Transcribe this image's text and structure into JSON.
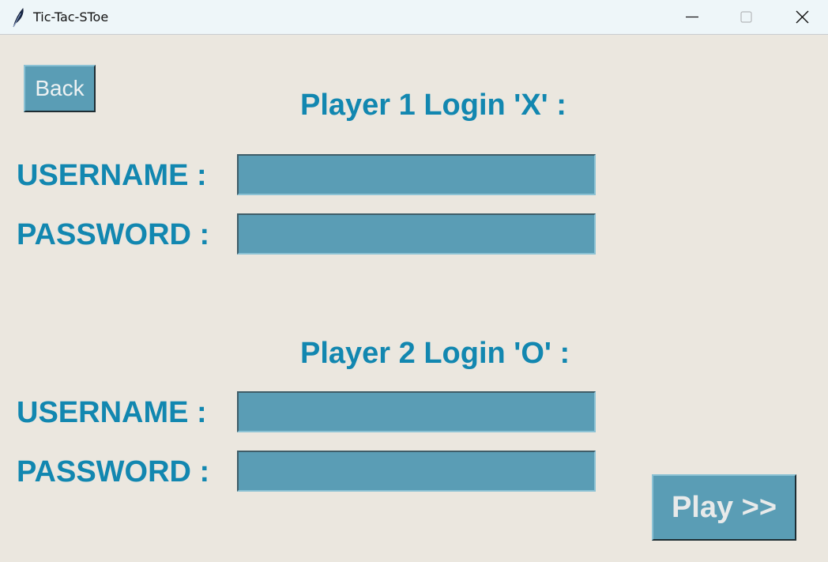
{
  "window": {
    "title": "Tic-Tac-SToe",
    "icon": "feather-icon",
    "controls": [
      "minimize-icon",
      "maximize-icon",
      "close-icon"
    ]
  },
  "back_button": {
    "label": "Back"
  },
  "player1": {
    "heading": "Player 1 Login 'X' :",
    "username_label": "USERNAME :",
    "password_label": "PASSWORD :",
    "username_value": "",
    "password_value": ""
  },
  "player2": {
    "heading": "Player 2 Login 'O' :",
    "username_label": "USERNAME :",
    "password_label": "PASSWORD :",
    "username_value": "",
    "password_value": ""
  },
  "play_button": {
    "label": "Play >>"
  },
  "colors": {
    "background": "#ebe7df",
    "accent_text": "#1287b0",
    "field_fill": "#5a9db5",
    "titlebar": "#eef6f9"
  }
}
